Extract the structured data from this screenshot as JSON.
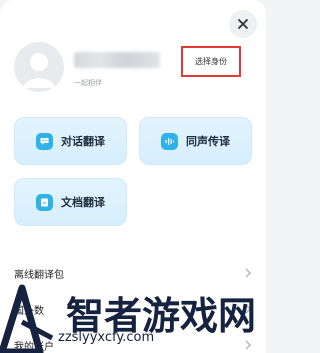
{
  "profile": {
    "subtitle": "一起相伴",
    "identity_button": "选择身份"
  },
  "features": [
    {
      "label": "对话翻译",
      "icon": "chat-bubble-icon"
    },
    {
      "label": "同声传译",
      "icon": "sound-wave-icon"
    },
    {
      "label": "文档翻译",
      "icon": "document-icon"
    }
  ],
  "menu": [
    {
      "label": "离线翻译包"
    },
    {
      "label": "国外数"
    },
    {
      "label": "我的账户"
    }
  ],
  "watermark": {
    "title": "智者游戏网",
    "url": "zzslyyxcfy.com"
  },
  "colors": {
    "accent": "#2fb2e8",
    "highlight_border": "#e53935",
    "card_bg": "#e3f4fd"
  }
}
